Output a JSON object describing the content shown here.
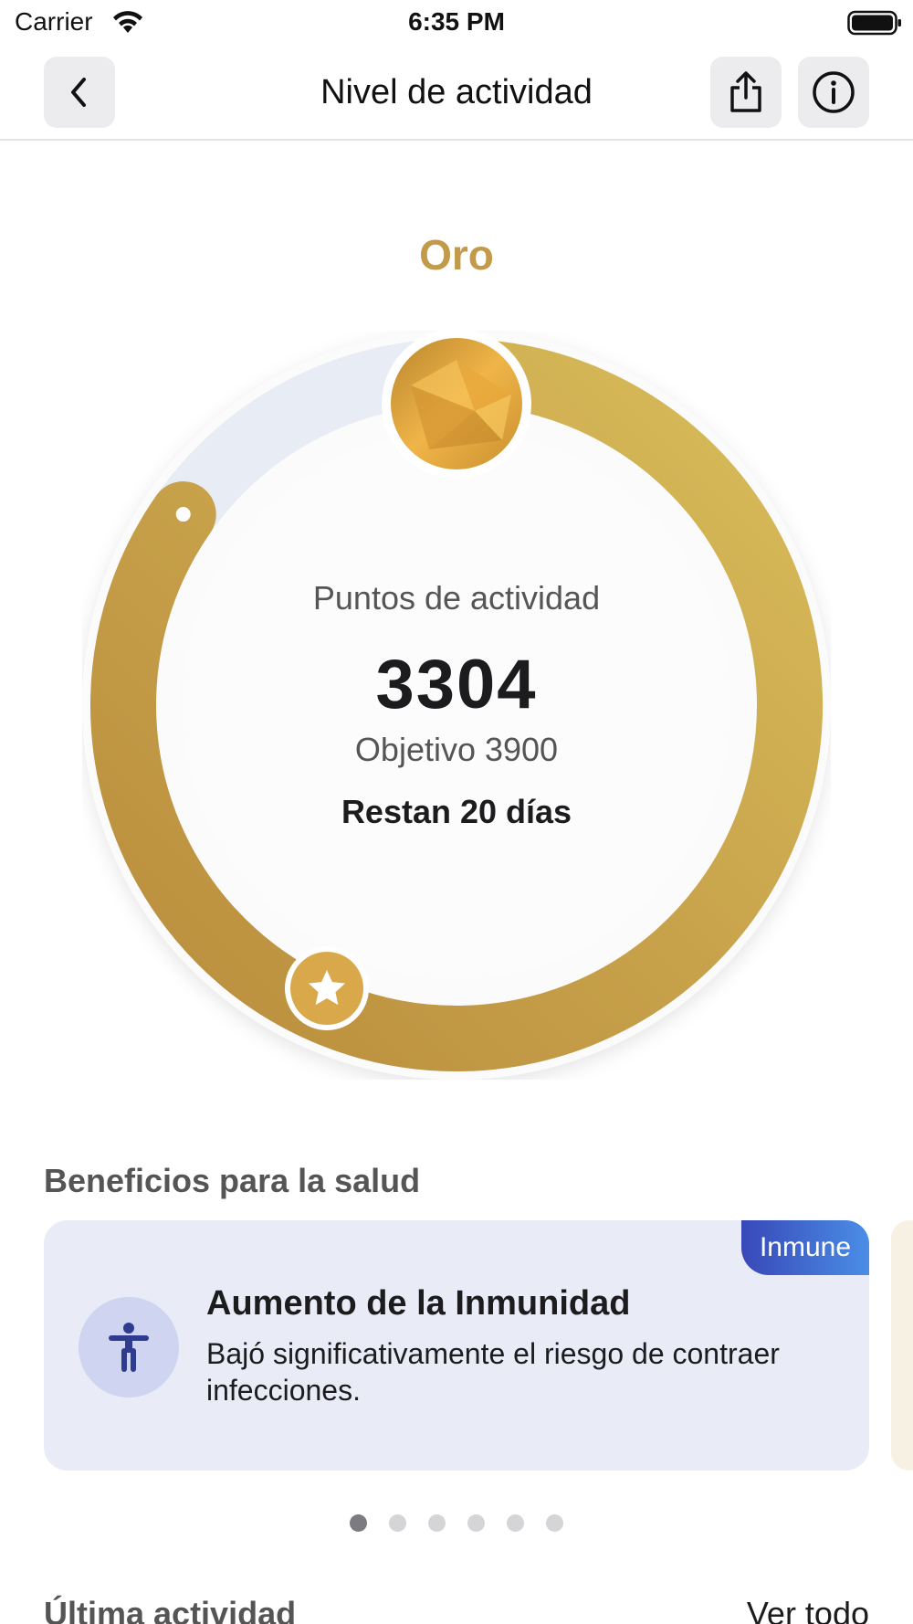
{
  "status_bar": {
    "carrier": "Carrier",
    "time": "6:35 PM"
  },
  "nav": {
    "title": "Nivel de actividad",
    "back_icon": "chevron-left-icon",
    "share_icon": "share-icon",
    "info_icon": "info-icon"
  },
  "level": {
    "name": "Oro",
    "badge_icon": "gold-medal-icon",
    "marker_icon": "star-icon"
  },
  "activity": {
    "points_label": "Puntos de actividad",
    "points_value": "3304",
    "goal_label": "Objetivo 3900",
    "days_left": "Restan 20 días",
    "progress_fraction": 0.847
  },
  "benefits": {
    "section_title": "Beneficios para la salud",
    "card": {
      "tag": "Inmune",
      "icon": "accessibility-person-icon",
      "title": "Aumento de la Inmunidad",
      "description": "Bajó significativamente el riesgo de contraer infecciones."
    },
    "pager_count": 6,
    "pager_active": 0
  },
  "last_activity": {
    "title": "Última actividad",
    "see_all": "Ver todo"
  },
  "colors": {
    "gold": "#c3994a",
    "gold_light": "#d8bd5a",
    "track": "#e8ecf4",
    "tag_start": "#3848b8",
    "tag_end": "#4a8ee6"
  }
}
